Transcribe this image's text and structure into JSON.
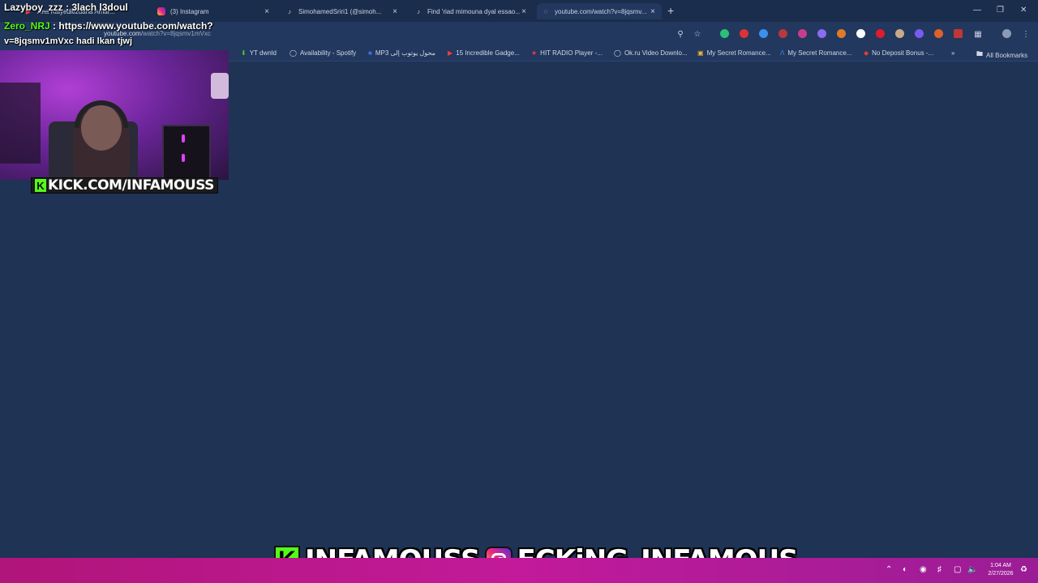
{
  "tabs": [
    {
      "label": "Ana Kaiyeditizuana Amar...",
      "icon": "youtube-icon"
    },
    {
      "label": "(3) Instagram",
      "icon": "instagram-icon"
    },
    {
      "label": "SimohamedSriri1 (@simoh...",
      "icon": "tiktok-icon"
    },
    {
      "label": "Find 'riad mimouna dyal essao...",
      "icon": "tiktok-icon"
    },
    {
      "label": "youtube.com/watch?v=8jqsmv...",
      "icon": "loading-icon",
      "active": true
    }
  ],
  "address_bar": {
    "host": "youtube.com",
    "path": "/watch?v=8jqsmv1mVxc"
  },
  "bookmarks": [
    {
      "label": "YT dwnld",
      "icon": "download-icon"
    },
    {
      "label": "Availability - Spotify",
      "icon": "globe-icon"
    },
    {
      "label": "MP3 محول يوتوب إلى",
      "icon": "mp3-icon"
    },
    {
      "label": "15 Incredible Gadge...",
      "icon": "youtube-icon"
    },
    {
      "label": "HIT RADIO Player -...",
      "icon": "star-icon"
    },
    {
      "label": "Ok.ru Video Downlo...",
      "icon": "globe-icon"
    },
    {
      "label": "My Secret Romance...",
      "icon": "image-icon"
    },
    {
      "label": "My Secret Romance...",
      "icon": "a-icon"
    },
    {
      "label": "No Deposit Bonus -...",
      "icon": "diamond-icon"
    }
  ],
  "all_bookmarks_label": "All Bookmarks",
  "overflow_label": "»",
  "chat": [
    {
      "user": "Lazyboy_zzz",
      "message": "3lach l3doul"
    },
    {
      "user": "Zero_NRJ",
      "message": "https://www.youtube.com/watch?",
      "message_line2": "v=8jqsmv1mVxc hadi lkan tjwj"
    }
  ],
  "separator": ":",
  "webcam_banner": {
    "logo": "K",
    "text": "KICK.COM/INFAMOUSS"
  },
  "bottom_banner": {
    "kick_logo": "K",
    "kick_handle": "INFAMOUSS",
    "instagram_handle": "FCKiNG_INFAMOUS"
  },
  "clock": {
    "time": "1:04 AM",
    "date": "2/27/2026"
  },
  "colors": {
    "page_bg": "#1f3355",
    "kick_green": "#53fc18",
    "taskbar": "#b0157a"
  }
}
